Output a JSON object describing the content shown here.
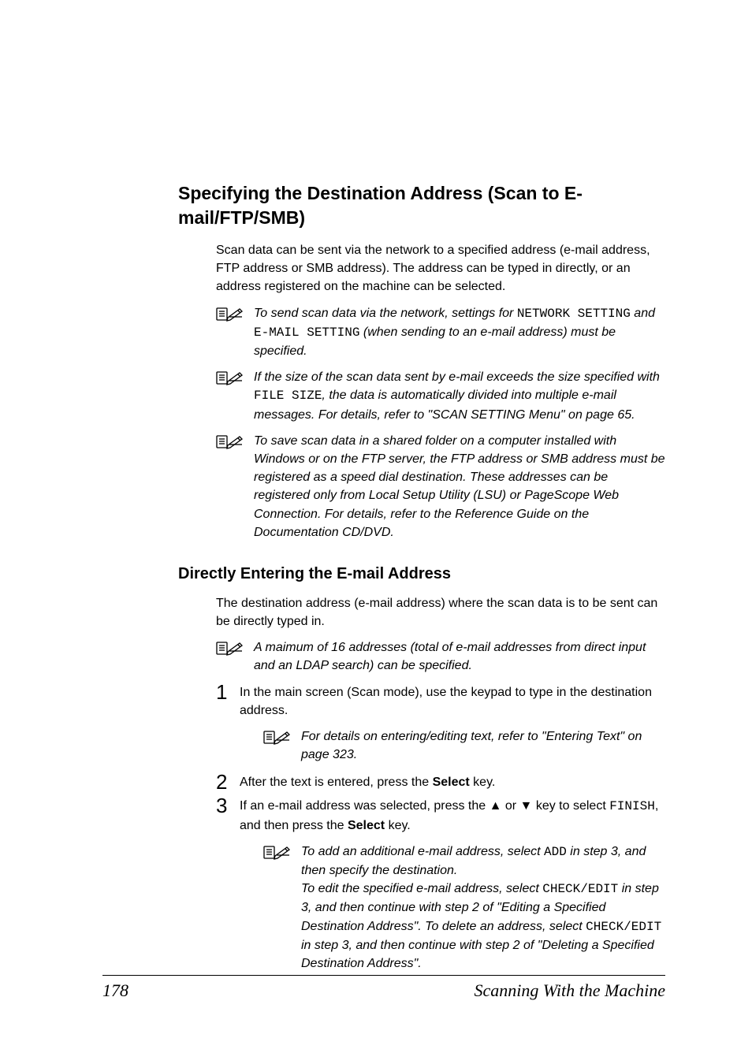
{
  "heading": "Specifying the Destination Address (Scan to E-mail/FTP/SMB)",
  "intro": "Scan data can be sent via the network to a specified address (e-mail address, FTP address or SMB address). The address can be typed in directly, or an address registered on the machine can be selected.",
  "note1_a": "To send scan data via the network, settings for ",
  "note1_b": "NETWORK SETTING",
  "note1_c": " and ",
  "note1_d": "E-MAIL SETTING",
  "note1_e": " (when sending to an e-mail address) must be specified.",
  "note2_a": "If the size of the scan data sent by e-mail exceeds the size specified with ",
  "note2_b": "FILE SIZE",
  "note2_c": ", the data is automatically divided into multiple e-mail messages. For details, refer to \"SCAN SETTING Menu\" on page 65.",
  "note3": "To save scan data in a shared folder on a computer installed with Windows or on the FTP server, the FTP address or SMB address must be registered as a speed dial destination. These addresses can be registered only from Local Setup Utility (LSU) or PageScope Web Connection. For details, refer to the Reference Guide on the Documentation CD/DVD.",
  "subheading": "Directly Entering the E-mail Address",
  "subintro": "The destination address (e-mail address) where the scan data is to be sent can be directly typed in.",
  "note4": "A maimum of 16 addresses (total of e-mail addresses from direct input and an LDAP search) can be specified.",
  "step1": "In the main screen (Scan mode), use the keypad to type in the destination address.",
  "step1_note": "For details on entering/editing text, refer to \"Entering Text\" on page 323.",
  "step2_a": "After the text is entered, press the ",
  "step2_b": "Select",
  "step2_c": " key.",
  "step3_a": "If an e-mail address was selected, press the ▲ or ▼ key to select ",
  "step3_b": "FINISH",
  "step3_c": ", and then press the ",
  "step3_d": "Select",
  "step3_e": " key.",
  "step3_note_a": "To add an additional e-mail address, select ",
  "step3_note_b": "ADD",
  "step3_note_c": " in step 3, and then specify the destination.",
  "step3_note_d": "To edit the specified e-mail address, select ",
  "step3_note_e": "CHECK/EDIT",
  "step3_note_f": " in step 3, and then continue with step 2 of \"Editing a Specified Destination Address\". To delete an address, select ",
  "step3_note_g": "CHECK/EDIT",
  "step3_note_h": " in step 3, and then continue with step 2 of \"Deleting a Specified Destination Address\".",
  "page_number": "178",
  "footer_title": "Scanning With the Machine"
}
